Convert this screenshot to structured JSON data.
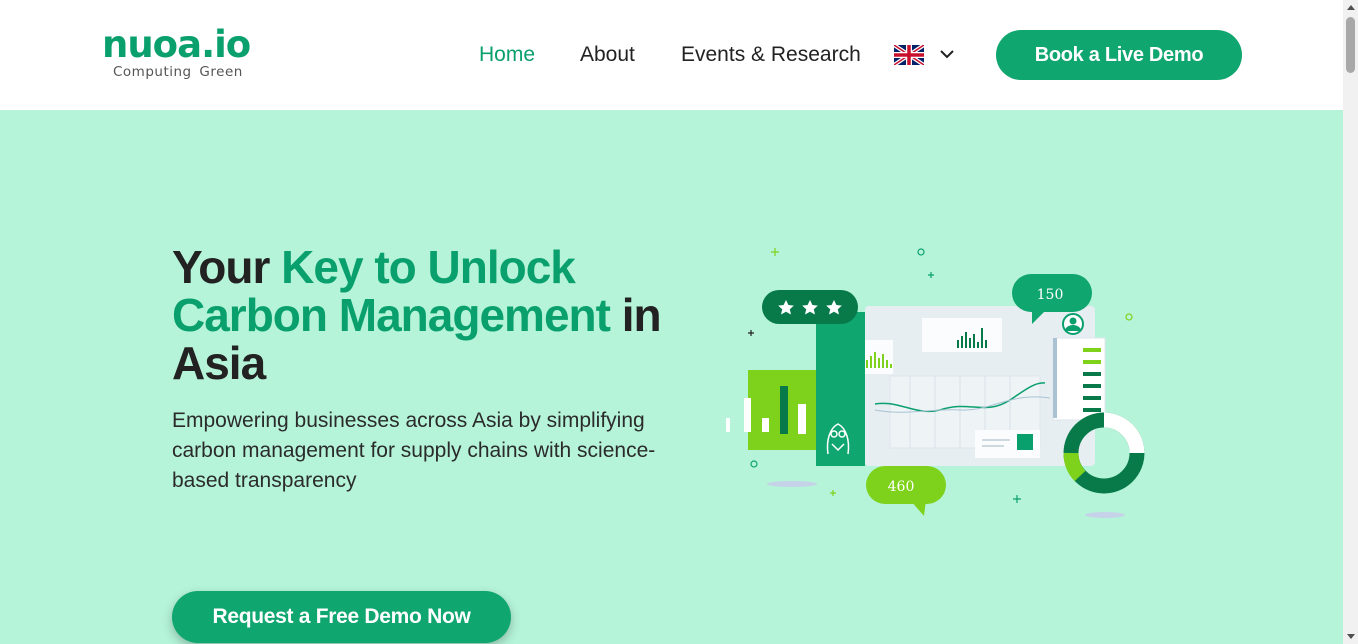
{
  "header": {
    "logo": {
      "name": "nuoa.io",
      "tagline": "Computing Green"
    },
    "nav": [
      {
        "label": "Home",
        "active": true
      },
      {
        "label": "About",
        "active": false
      },
      {
        "label": "Events & Research",
        "active": false
      }
    ],
    "language": {
      "icon": "uk-flag-icon",
      "dropdown_icon": "chevron-down-icon"
    },
    "cta_label": "Book a Live Demo"
  },
  "hero": {
    "headline": {
      "part1": "Your ",
      "highlight": "Key to Unlock Carbon Management",
      "part2": " in Asia"
    },
    "subtext": "Empowering businesses across Asia by simplifying carbon management for supply chains with science-based transparency",
    "cta_label": "Request a Free Demo Now",
    "illustration": {
      "bubble_top": "150",
      "bubble_bottom": "460",
      "icons": [
        "star-icon",
        "owl-logo-icon",
        "user-icon",
        "donut-chart-icon",
        "bar-chart-icon",
        "line-chart-icon"
      ]
    }
  },
  "colors": {
    "brand": "#0aa06e",
    "button": "#10a66f",
    "hero_bg": "#b5f4d9",
    "dark_green": "#087a4a",
    "lime": "#7fd21c"
  }
}
